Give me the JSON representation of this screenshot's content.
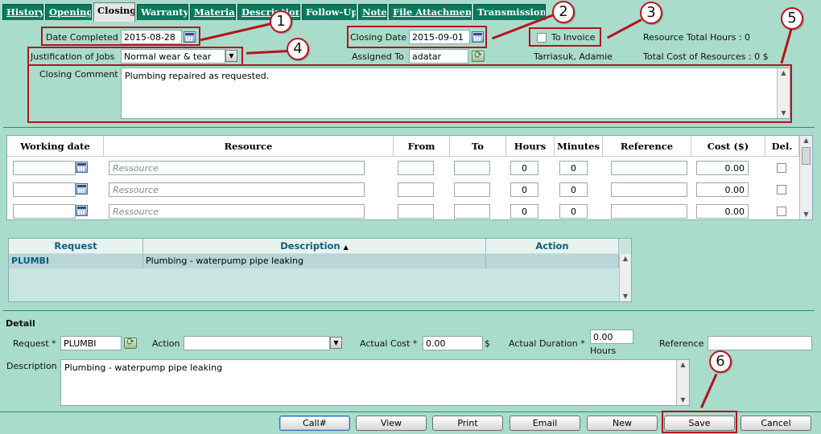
{
  "tabs": [
    {
      "label": "History",
      "active": false,
      "underline": true
    },
    {
      "label": "Opening",
      "active": false,
      "underline": true
    },
    {
      "label": "Closing",
      "active": true,
      "underline": false
    },
    {
      "label": "Warranty",
      "active": false,
      "underline": false
    },
    {
      "label": "Material",
      "active": false,
      "underline": true
    },
    {
      "label": "Description",
      "active": false,
      "underline": true
    },
    {
      "label": "Follow-Up",
      "active": false,
      "underline": false
    },
    {
      "label": "Note",
      "active": false,
      "underline": true
    },
    {
      "label": "File Attachment",
      "active": false,
      "underline": true
    },
    {
      "label": "Transmission",
      "active": false,
      "underline": false
    }
  ],
  "closing": {
    "date_completed_label": "Date Completed",
    "date_completed": "2015-08-28",
    "closing_date_label": "Closing Date",
    "closing_date": "2015-09-01",
    "to_invoice_label": "To Invoice",
    "resource_total_hours": "Resource Total Hours : 0",
    "justification_label": "Justification of Jobs",
    "justification": "Normal wear & tear",
    "assigned_to_label": "Assigned To",
    "assigned_to": "adatar",
    "assigned_name": "Tarriasuk, Adamie",
    "total_cost": "Total Cost of Resources : 0 $",
    "closing_comment_label": "Closing Comment",
    "closing_comment": "Plumbing repaired as requested."
  },
  "resources": {
    "headers": [
      "Working date",
      "Resource",
      "From",
      "To",
      "Hours",
      "Minutes",
      "Reference",
      "Cost ($)",
      "Del."
    ],
    "resource_placeholder": "Ressource",
    "rows": [
      {
        "hours": "0",
        "minutes": "0",
        "cost": "0.00"
      },
      {
        "hours": "0",
        "minutes": "0",
        "cost": "0.00"
      },
      {
        "hours": "0",
        "minutes": "0",
        "cost": "0.00"
      }
    ]
  },
  "requests": {
    "headers": [
      "Request",
      "Description",
      "Action"
    ],
    "sort_indicator": "▲",
    "rows": [
      {
        "request": "PLUMBI",
        "description": "Plumbing - waterpump pipe leaking",
        "action": ""
      }
    ]
  },
  "detail": {
    "title": "Detail",
    "request_label": "Request *",
    "request": "PLUMBI",
    "action_label": "Action",
    "action": "",
    "actual_cost_label": "Actual Cost *",
    "actual_cost": "0.00",
    "currency": "$",
    "actual_duration_label": "Actual Duration *",
    "actual_duration": "0.00",
    "duration_unit": "Hours",
    "reference_label": "Reference",
    "reference": "",
    "description_label": "Description",
    "description": "Plumbing - waterpump pipe leaking"
  },
  "buttons": {
    "call": "Call#",
    "view": "View",
    "print": "Print",
    "email": "Email",
    "new": "New",
    "save": "Save",
    "cancel": "Cancel"
  },
  "callouts": [
    "1",
    "2",
    "3",
    "4",
    "5",
    "6"
  ],
  "colors": {
    "background": "#a9dccb",
    "tab": "#0a7a5e",
    "highlight_box": "#b3141c",
    "request_link": "#0a5f7e"
  }
}
